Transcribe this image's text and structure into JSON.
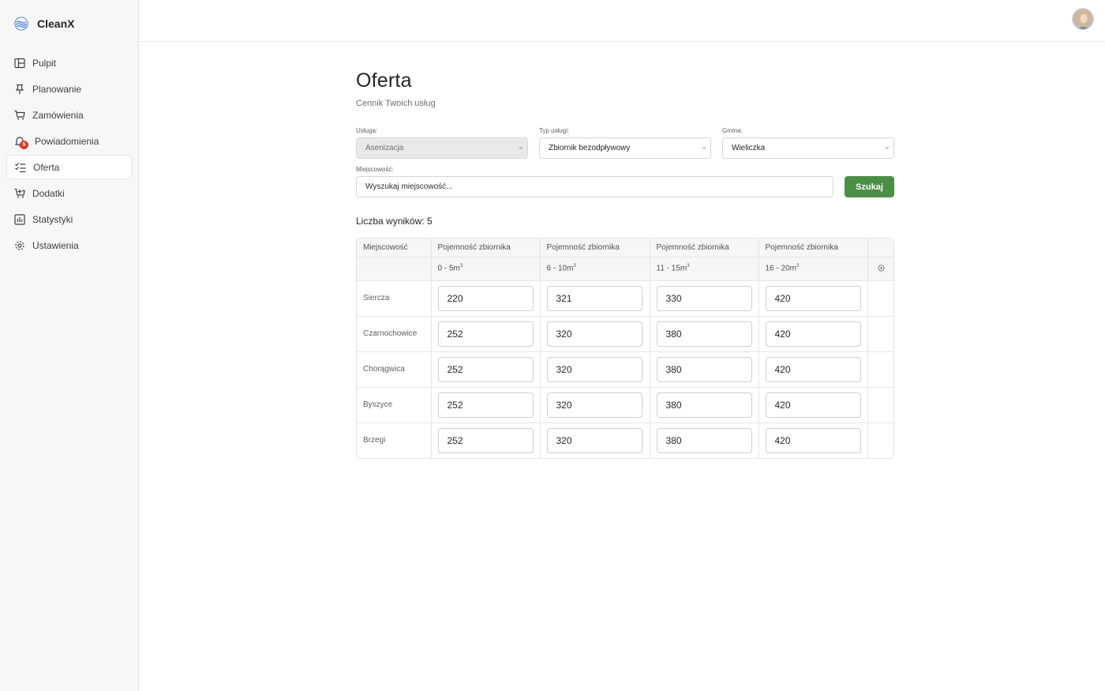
{
  "app": {
    "name": "CleanX"
  },
  "sidebar": {
    "items": [
      {
        "label": "Pulpit",
        "icon": "layout-icon"
      },
      {
        "label": "Planowanie",
        "icon": "pin-icon"
      },
      {
        "label": "Zamówienia",
        "icon": "cart-icon"
      },
      {
        "label": "Powiadomienia",
        "icon": "bell-icon",
        "badge": "5"
      },
      {
        "label": "Oferta",
        "icon": "checklist-icon",
        "active": true
      },
      {
        "label": "Dodatki",
        "icon": "cart-plus-icon"
      },
      {
        "label": "Statystyki",
        "icon": "chart-icon"
      },
      {
        "label": "Ustawienia",
        "icon": "gear-icon"
      }
    ]
  },
  "page": {
    "title": "Oferta",
    "subtitle": "Cennik Twoich usług"
  },
  "filters": {
    "service_label": "Usługa:",
    "service_value": "Asenizacja",
    "type_label": "Typ usługi:",
    "type_value": "Zbiornik bezodpływowy",
    "commune_label": "Gmina:",
    "commune_value": "Wieliczka",
    "locality_label": "Miejscowość:",
    "locality_placeholder": "Wyszukaj miejscowość...",
    "search_button": "Szukaj"
  },
  "results": {
    "label": "Liczba wyników: 5"
  },
  "table": {
    "locality_header": "Miejscowość",
    "columns": [
      {
        "header": "Pojemność zbiornika",
        "range": "0 - 5m",
        "unit_sup": "3"
      },
      {
        "header": "Pojemność zbiornika",
        "range": "6 - 10m",
        "unit_sup": "3"
      },
      {
        "header": "Pojemność zbiornika",
        "range": "11 - 15m",
        "unit_sup": "3"
      },
      {
        "header": "Pojemność zbiornika",
        "range": "16 - 20m",
        "unit_sup": "3"
      }
    ],
    "rows": [
      {
        "locality": "Siercza",
        "prices": [
          "220",
          "321",
          "330",
          "420"
        ]
      },
      {
        "locality": "Czarnochowice",
        "prices": [
          "252",
          "320",
          "380",
          "420"
        ]
      },
      {
        "locality": "Chorągwica",
        "prices": [
          "252",
          "320",
          "380",
          "420"
        ]
      },
      {
        "locality": "Byszyce",
        "prices": [
          "252",
          "320",
          "380",
          "420"
        ]
      },
      {
        "locality": "Brzegi",
        "prices": [
          "252",
          "320",
          "380",
          "420"
        ]
      }
    ]
  },
  "colors": {
    "accent": "#4a8f45",
    "badge": "#d93a2b",
    "sidebar_bg": "#f7f7f7"
  }
}
